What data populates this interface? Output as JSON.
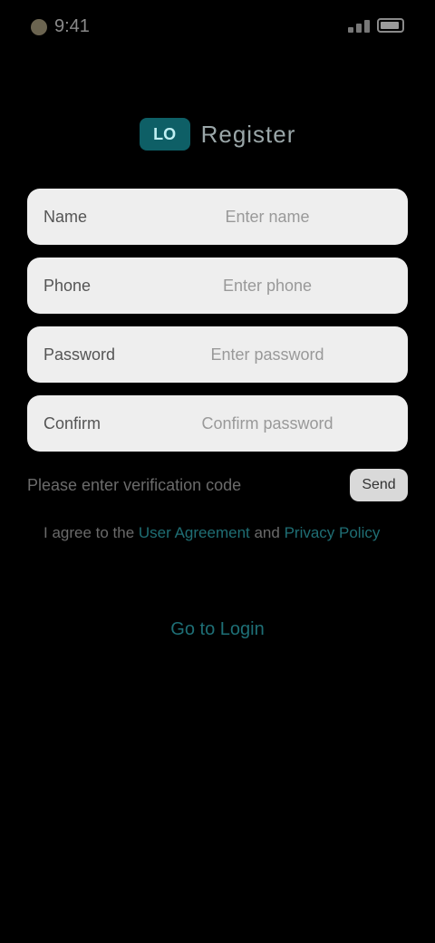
{
  "status_bar": {
    "time": "9:41"
  },
  "brand": {
    "logo_text": "LO",
    "name": "Register"
  },
  "fields": [
    {
      "label": "Name",
      "placeholder": "Enter name"
    },
    {
      "label": "Phone",
      "placeholder": "Enter phone"
    },
    {
      "label": "Password",
      "placeholder": "Enter password"
    },
    {
      "label": "Confirm",
      "placeholder": "Confirm password"
    }
  ],
  "verification": {
    "text": "Please enter verification code",
    "button_label": "Send"
  },
  "agreement": {
    "prefix": "I agree to the ",
    "link_terms": "User Agreement",
    "middle": " and ",
    "link_privacy": "Privacy Policy"
  },
  "actions": {
    "login_link": "Go to Login"
  },
  "colors": {
    "accent": "#1e6f76",
    "field_bg": "#eeeeee",
    "background": "#000000"
  }
}
